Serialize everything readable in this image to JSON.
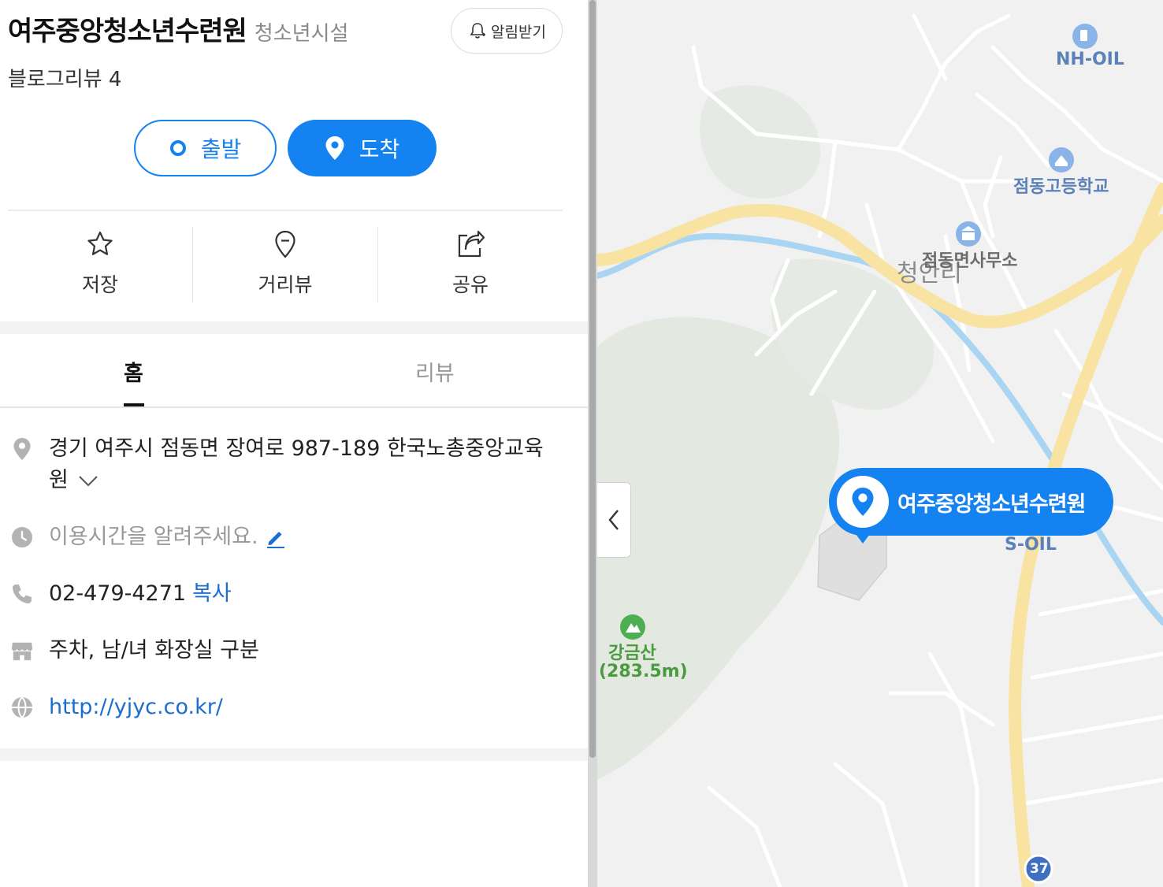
{
  "place": {
    "name": "여주중앙청소년수련원",
    "category": "청소년시설",
    "alarm_label": "알림받기",
    "review_count_text": "블로그리뷰 4"
  },
  "route": {
    "start_label": "출발",
    "dest_label": "도착"
  },
  "actions": {
    "save": "저장",
    "roadview": "거리뷰",
    "share": "공유"
  },
  "tabs": {
    "home": "홈",
    "review": "리뷰",
    "active": "home"
  },
  "info": {
    "address_line1": "경기 여주시 점동면 장여로 987-189 한국노총중앙교육",
    "address_line2": "원",
    "hours_prompt": "이용시간을 알려주세요.",
    "phone": "02-479-4271",
    "copy_label": "복사",
    "facilities": "주차, 남/녀 화장실 구분",
    "website": "http://yjyc.co.kr/"
  },
  "map": {
    "labels": {
      "nh_oil": "NH-OIL",
      "school": "점동고등학교",
      "office": "점동면사무소",
      "village": "청안리",
      "s_oil": "S-OIL",
      "mountain_name": "강금산",
      "mountain_height": "(283.5m)",
      "route_number": "37"
    },
    "marker_label": "여주중앙청소년수련원"
  },
  "colors": {
    "accent": "#1482f0",
    "road_major": "#f8e3a3",
    "river": "#a9d4f2",
    "forest": "#e3e8e1",
    "link": "#1a6dd1",
    "mountain_green": "#4caf50"
  }
}
